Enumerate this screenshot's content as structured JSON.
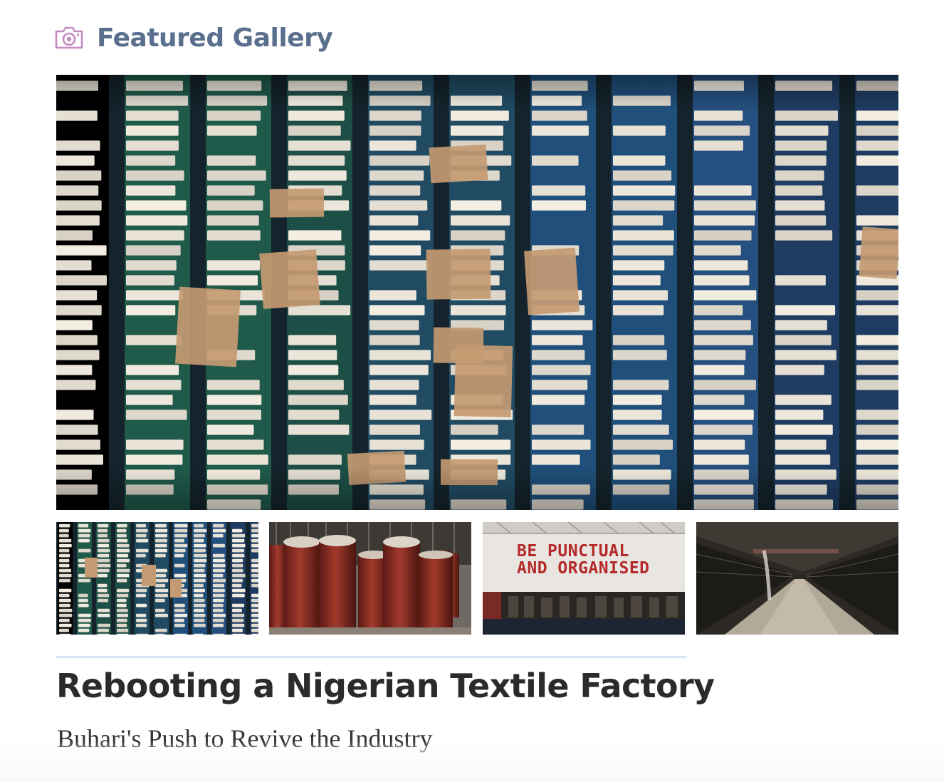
{
  "header": {
    "icon": "camera-icon",
    "title": "Featured Gallery",
    "icon_color": "#c48ac0",
    "title_color": "#5a6f8d"
  },
  "gallery": {
    "main_image": "textile-factory-punch-card-racks-photo",
    "thumbnails": [
      {
        "image": "punch-card-racks-thumbnail"
      },
      {
        "image": "yarn-cans-thumbnail"
      },
      {
        "image": "factory-wall-sign-thumbnail",
        "text_line_1": "BE PUNCTUAL",
        "text_line_2": "AND ORGANISED"
      },
      {
        "image": "spinning-hall-thumbnail"
      }
    ]
  },
  "article": {
    "title": "Rebooting a Nigerian Textile Factory",
    "subtitle": "Buhari's Push to Revive the Industry"
  }
}
